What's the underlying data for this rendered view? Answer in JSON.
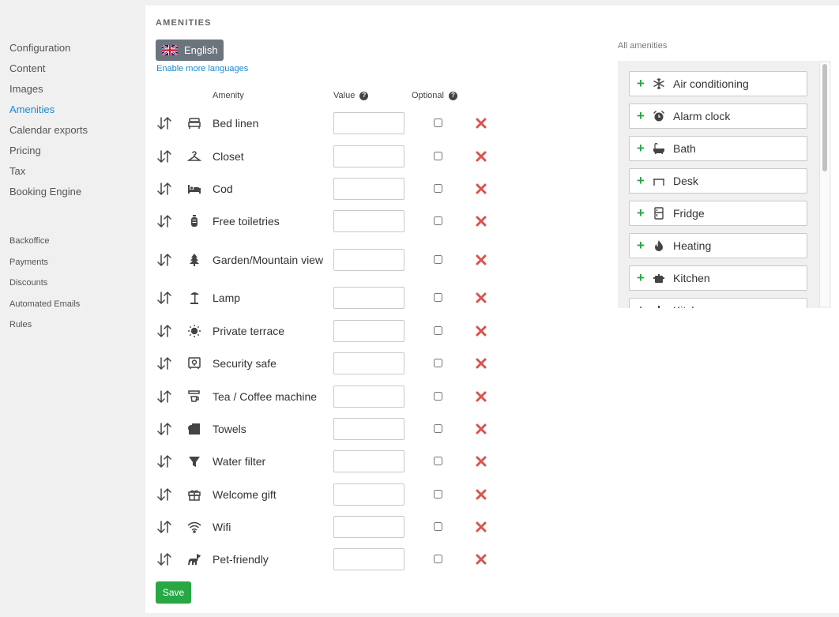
{
  "sidebar": {
    "main": [
      {
        "label": "Configuration",
        "active": false
      },
      {
        "label": "Content",
        "active": false
      },
      {
        "label": "Images",
        "active": false
      },
      {
        "label": "Amenities",
        "active": true
      },
      {
        "label": "Calendar exports",
        "active": false
      },
      {
        "label": "Pricing",
        "active": false
      },
      {
        "label": "Tax",
        "active": false
      },
      {
        "label": "Booking Engine",
        "active": false
      }
    ],
    "secondary": [
      {
        "label": "Backoffice"
      },
      {
        "label": "Payments"
      },
      {
        "label": "Discounts"
      },
      {
        "label": "Automated Emails"
      },
      {
        "label": "Rules"
      }
    ],
    "active_color": "#1a8acb"
  },
  "amenities": {
    "title": "AMENITIES",
    "language_button": "English",
    "language_flag": "uk-flag-icon",
    "enable_languages": "Enable more languages",
    "columns": {
      "amenity": "Amenity",
      "value": "Value",
      "optional": "Optional"
    },
    "rows": [
      {
        "name": "Bed linen",
        "icon": "bed-linen-icon",
        "value": "",
        "optional": false
      },
      {
        "name": "Closet",
        "icon": "hanger-icon",
        "value": "",
        "optional": false
      },
      {
        "name": "Cod",
        "icon": "cot-icon",
        "value": "",
        "optional": false
      },
      {
        "name": "Free toiletries",
        "icon": "toiletries-icon",
        "value": "",
        "optional": false
      },
      {
        "name": "Garden/Mountain view",
        "icon": "tree-icon",
        "value": "",
        "optional": false
      },
      {
        "name": "Lamp",
        "icon": "lamp-icon",
        "value": "",
        "optional": false
      },
      {
        "name": "Private terrace",
        "icon": "sun-icon",
        "value": "",
        "optional": false
      },
      {
        "name": "Security safe",
        "icon": "safe-icon",
        "value": "",
        "optional": false
      },
      {
        "name": "Tea / Coffee machine",
        "icon": "coffee-machine-icon",
        "value": "",
        "optional": false
      },
      {
        "name": "Towels",
        "icon": "towel-icon",
        "value": "",
        "optional": false
      },
      {
        "name": "Water filter",
        "icon": "filter-icon",
        "value": "",
        "optional": false
      },
      {
        "name": "Welcome gift",
        "icon": "gift-icon",
        "value": "",
        "optional": false
      },
      {
        "name": "Wifi",
        "icon": "wifi-icon",
        "value": "",
        "optional": false
      },
      {
        "name": "Pet-friendly",
        "icon": "dog-icon",
        "value": "",
        "optional": false
      }
    ],
    "save_label": "Save"
  },
  "all_amenities": {
    "title": "All amenities",
    "items": [
      {
        "label": "Air conditioning",
        "icon": "snowflake-icon"
      },
      {
        "label": "Alarm clock",
        "icon": "alarm-clock-icon"
      },
      {
        "label": "Bath",
        "icon": "bathtub-icon"
      },
      {
        "label": "Desk",
        "icon": "desk-icon"
      },
      {
        "label": "Fridge",
        "icon": "fridge-icon"
      },
      {
        "label": "Heating",
        "icon": "flame-icon"
      },
      {
        "label": "Kitchen",
        "icon": "pot-icon"
      },
      {
        "label": "Kitchenware",
        "icon": "kitchenware-icon"
      }
    ]
  },
  "colors": {
    "primary": "#1a8acb",
    "success": "#28a745",
    "danger": "#d9534f",
    "secondary": "#6c757d"
  }
}
